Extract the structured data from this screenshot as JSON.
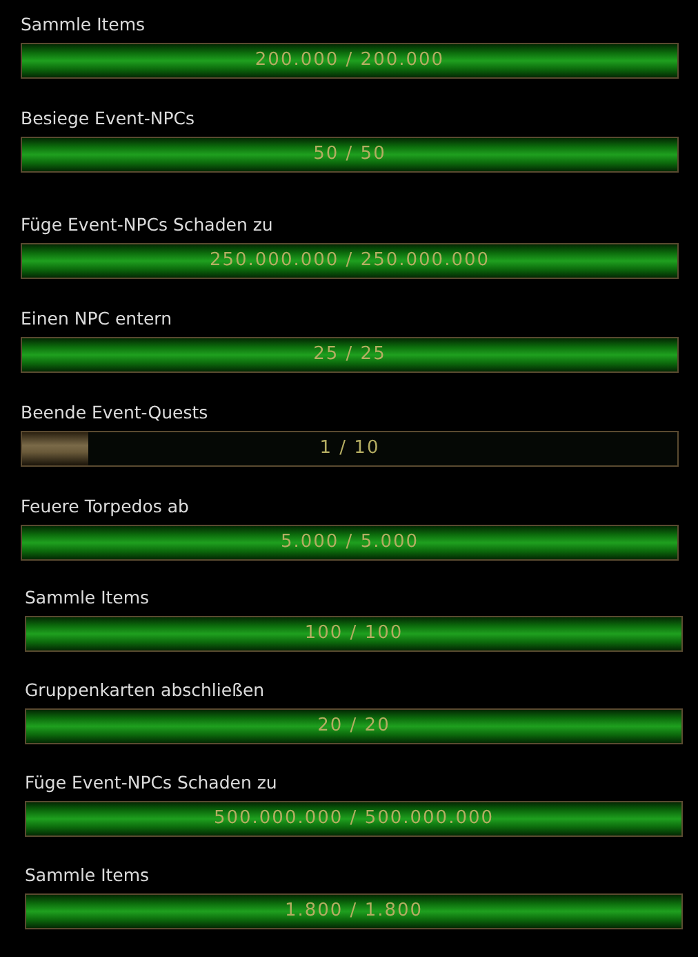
{
  "groups": [
    {
      "tasks": [
        {
          "label": "Sammle Items",
          "reading": "200.000 / 200.000",
          "level": 1
        },
        {
          "label": "Besiege Event-NPCs",
          "reading": "50 / 50",
          "level": 1
        },
        {
          "label": "Füge Event-NPCs Schaden zu",
          "reading": "250.000.000 / 250.000.000",
          "level": 1
        },
        {
          "label": "Einen NPC entern",
          "reading": "25 / 25",
          "level": 1
        },
        {
          "label": "Beende Event-Quests",
          "reading": "1 / 10",
          "level": 0.1
        },
        {
          "label": "Feuere Torpedos ab",
          "reading": "5.000 / 5.000",
          "level": 1
        }
      ]
    },
    {
      "tasks": [
        {
          "label": "Sammle Items",
          "reading": "100 / 100",
          "level": 1
        },
        {
          "label": "Gruppenkarten abschließen",
          "reading": "20 / 20",
          "level": 1
        },
        {
          "label": "Füge Event-NPCs Schaden zu",
          "reading": "500.000.000 / 500.000.000",
          "level": 1
        },
        {
          "label": "Sammle Items",
          "reading": "1.800 / 1.800",
          "level": 1
        }
      ]
    }
  ]
}
